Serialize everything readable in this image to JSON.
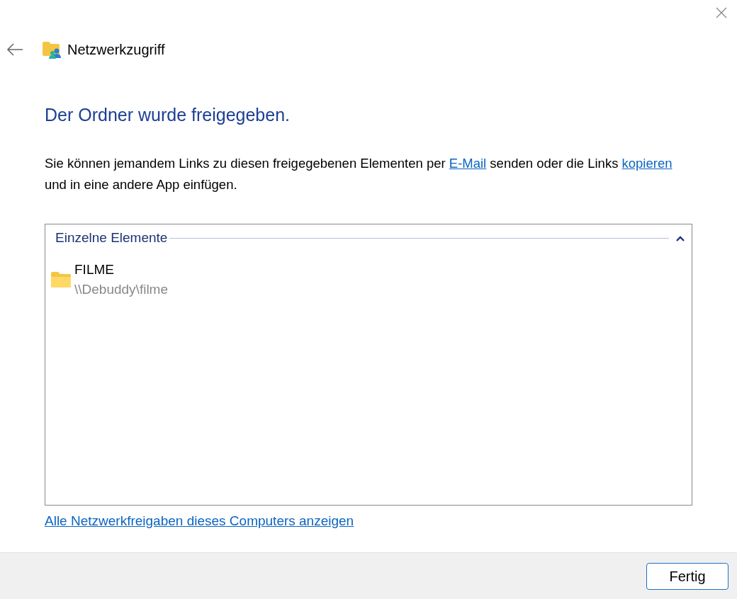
{
  "window": {
    "title": "Netzwerkzugriff"
  },
  "heading": "Der Ordner wurde freigegeben.",
  "description": [
    {
      "kind": "text",
      "text": "Sie können jemandem Links zu diesen freigegebenen Elementen per "
    },
    {
      "kind": "link",
      "text": "E-Mail"
    },
    {
      "kind": "text",
      "text": " senden oder die Links "
    },
    {
      "kind": "link",
      "text": "kopieren"
    },
    {
      "kind": "text",
      "text": " und in eine andere App einfügen."
    }
  ],
  "group": {
    "title": "Einzelne Elemente",
    "expanded": true,
    "items": [
      {
        "name": "FILME",
        "path": "\\\\Debuddy\\filme"
      }
    ]
  },
  "show_all_link": "Alle Netzwerkfreigaben dieses Computers anzeigen",
  "buttons": [
    "Fertig"
  ]
}
